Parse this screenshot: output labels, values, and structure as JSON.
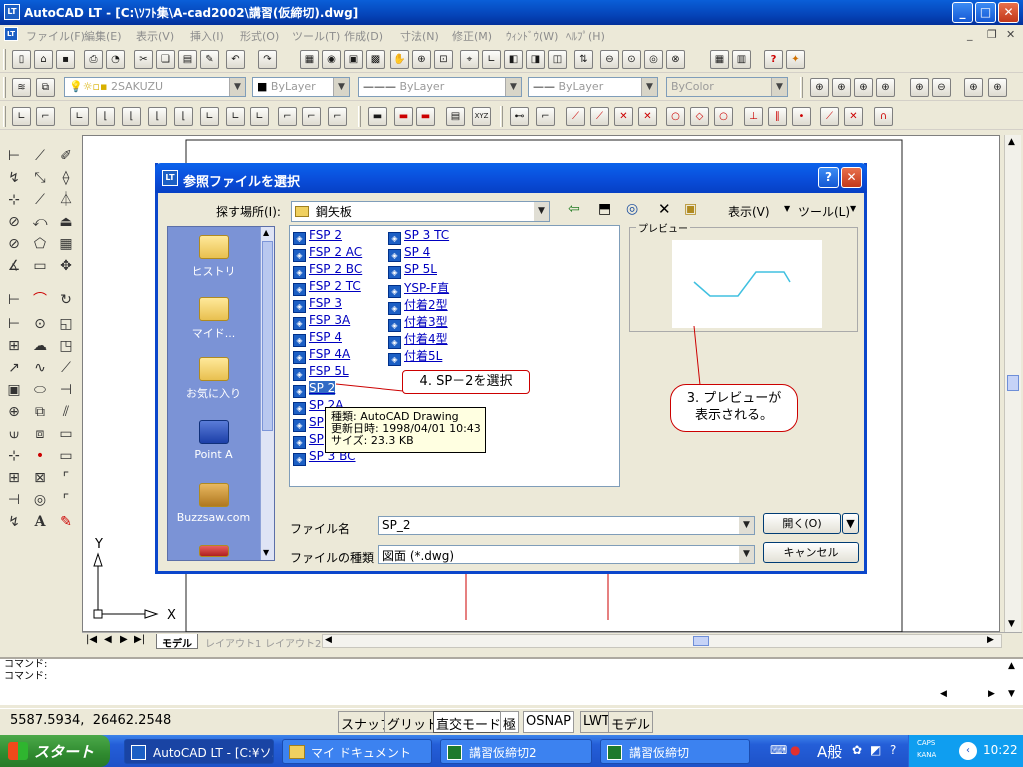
{
  "app": {
    "title": "AutoCAD LT - [C:\\ｿﾌﾄ集\\A-cad2002\\講習(仮締切).dwg]",
    "icon": "LT"
  },
  "menu": [
    "ファイル(F)",
    "編集(E)",
    "表示(V)",
    "挿入(I)",
    "形式(O)",
    "ツール(T)",
    "作成(D)",
    "寸法(N)",
    "修正(M)",
    "ｳｨﾝﾄﾞｳ(W)",
    "ﾍﾙﾌﾟ(H)"
  ],
  "layer": {
    "name": "2SAKUZU",
    "color": "ByLayer",
    "linetype": "ByLayer",
    "lineweight": "ByLayer",
    "plot": "ByColor"
  },
  "canvas": {
    "y_axis": "Y",
    "x_axis": "X"
  },
  "tabs": {
    "model": "モデル",
    "layout1": "レイアウト1",
    "layout2": "レイアウト2"
  },
  "command": {
    "line1": "コマンド:",
    "line2": "コマンド:"
  },
  "status": {
    "coords": "5587.5934,  26462.2548",
    "snap": "スナップ",
    "grid": "グリッド",
    "ortho": "直交モード",
    "polar": "極",
    "osnap": "OSNAP",
    "lwt": "LWT",
    "model": "モデル"
  },
  "taskbar": {
    "start": "スタート",
    "tasks": [
      "AutoCAD LT - [C:¥ソ...",
      "マイ ドキュメント",
      "講習仮締切2",
      "講習仮締切"
    ],
    "ime": "A般",
    "caps": "CAPS",
    "kana": "KANA",
    "time": "10:22"
  },
  "dialog": {
    "title": "参照ファイルを選択",
    "lookin_label": "探す場所(I):",
    "lookin_value": "鋼矢板",
    "view_menu": "表示(V)",
    "tools_menu": "ツール(L)",
    "preview_label": "プレビュー",
    "places": [
      "ヒストリ",
      "マイド...",
      "お気に入り",
      "Point A",
      "Buzzsaw.com"
    ],
    "files_col1": [
      "FSP 2",
      "FSP 2 AC",
      "FSP 2 BC",
      "FSP 2 TC",
      "FSP 3",
      "FSP 3A",
      "FSP 4",
      "FSP 4A",
      "FSP 5L",
      "SP 2",
      "SP 2A",
      "SP",
      "SP",
      "SP 3 BC"
    ],
    "files_col2": [
      "SP 3 TC",
      "SP 4",
      "SP 5L",
      "YSP-F直",
      "付着2型",
      "付着3型",
      "付着4型",
      "付着5L"
    ],
    "selected": "SP 2",
    "tooltip": {
      "kind": "種類: AutoCAD Drawing",
      "date": "更新日時: 1998/04/01 10:43",
      "size": "サイズ: 23.3 KB"
    },
    "filename_label": "ファイル名",
    "filename_value": "SP_2",
    "filetype_label": "ファイルの種類",
    "filetype_value": "図面 (*.dwg)",
    "open_button": "開く(O)",
    "cancel_button": "キャンセル"
  },
  "annotations": {
    "select": "4. SP－2を選択",
    "preview_line1": "3. プレビューが",
    "preview_line2": "表示される。"
  }
}
